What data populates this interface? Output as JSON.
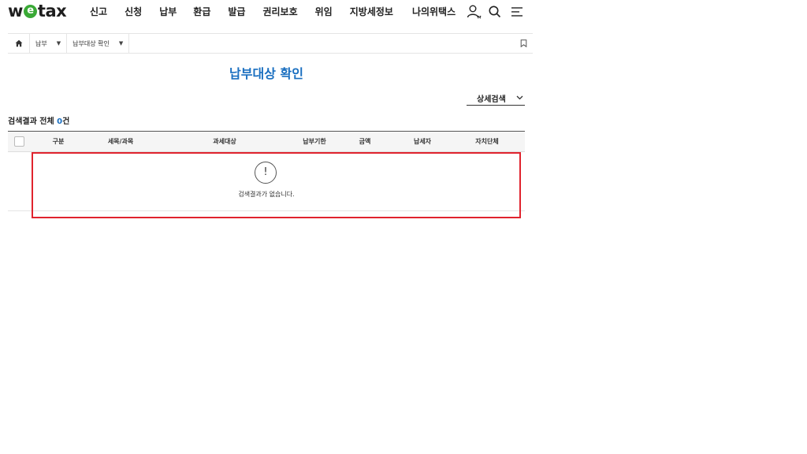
{
  "header": {
    "logo": {
      "before": "w",
      "e": "e",
      "after": "tax"
    },
    "nav": [
      "신고",
      "신청",
      "납부",
      "환급",
      "발급",
      "권리보호",
      "위임",
      "지방세정보",
      "나의위택스"
    ],
    "icons": {
      "my": "user-my-icon",
      "search": "search-icon",
      "menu": "hamburger-menu-icon"
    },
    "my_badge": "MY",
    "logo_accent": "#3aa936"
  },
  "breadcrumb": {
    "home_icon": "home-icon",
    "items": [
      {
        "label": "납부",
        "caret": "▼"
      },
      {
        "label": "납부대상 확인",
        "caret": "▼"
      }
    ],
    "bookmark_icon": "bookmark-icon"
  },
  "page": {
    "title": "납부대상 확인",
    "title_color": "#1a6fc0",
    "detail_search": {
      "label": "상세검색",
      "icon": "chevron-down-icon"
    },
    "result": {
      "prefix": "검색결과 전체",
      "count": "0",
      "suffix": "건"
    }
  },
  "table": {
    "columns": [
      "구분",
      "세목/과목",
      "과세대상",
      "납부기한",
      "금액",
      "납세자",
      "자치단체"
    ],
    "rows": [],
    "empty": {
      "icon": "!",
      "message": "검색결과가 없습니다."
    }
  },
  "highlight_color": "#e0232e"
}
